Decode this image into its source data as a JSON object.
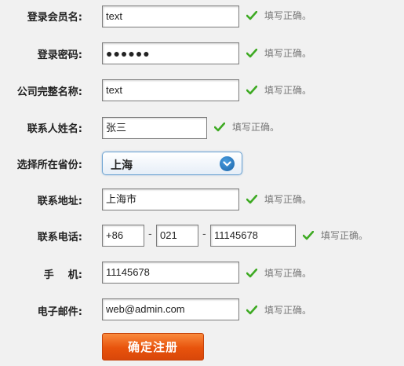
{
  "form": {
    "success_hint": "填写正确。",
    "fields": {
      "username": {
        "label": "登录会员名:",
        "value": "text"
      },
      "password": {
        "label": "登录密码:",
        "value": "●●●●●●"
      },
      "company": {
        "label": "公司完整名称:",
        "value": "text"
      },
      "contact": {
        "label": "联系人姓名:",
        "value": "张三"
      },
      "province": {
        "label": "选择所在省份:",
        "value": "上海"
      },
      "address": {
        "label": "联系地址:",
        "value": "上海市"
      },
      "phone": {
        "label": "联系电话:",
        "country": "+86",
        "area": "021",
        "number": "11145678",
        "separator": "-"
      },
      "mobile": {
        "label": "手    机:",
        "value": "11145678"
      },
      "email": {
        "label": "电子邮件:",
        "value": "web@admin.com"
      }
    },
    "submit_label": "确定注册"
  },
  "colors": {
    "check": "#3eaa23",
    "submit": "#e8530c",
    "select_border": "#6ea4d2"
  },
  "icons": {
    "check": "check-icon",
    "dropdown": "chevron-down-icon"
  }
}
